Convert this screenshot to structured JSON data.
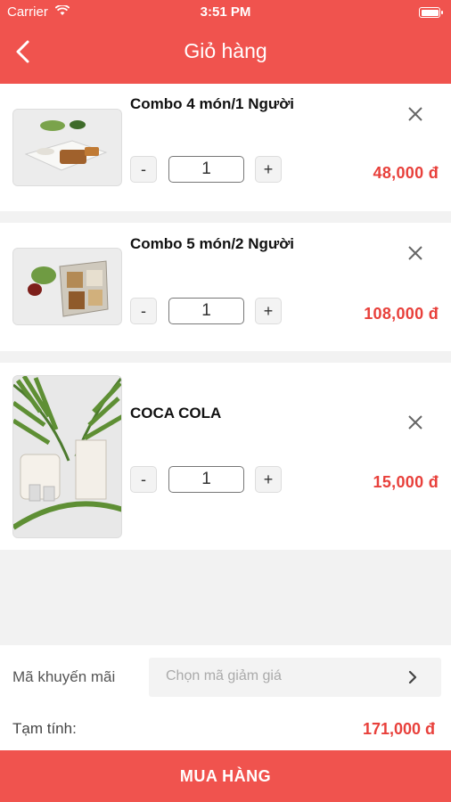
{
  "status_bar": {
    "carrier": "Carrier",
    "time": "3:51 PM"
  },
  "nav": {
    "title": "Giỏ hàng"
  },
  "cart_items": [
    {
      "name": "Combo 4 món/1 Người",
      "quantity": "1",
      "price": "48,000 đ",
      "minus": "-",
      "plus": "+"
    },
    {
      "name": "Combo 5 món/2 Người",
      "quantity": "1",
      "price": "108,000 đ",
      "minus": "-",
      "plus": "+"
    },
    {
      "name": "COCA COLA",
      "quantity": "1",
      "price": "15,000 đ",
      "minus": "-",
      "plus": "+"
    }
  ],
  "promo": {
    "label": "Mã khuyến mãi",
    "placeholder": "Chọn mã giảm giá"
  },
  "subtotal": {
    "label": "Tạm tính:",
    "value": "171,000 đ"
  },
  "checkout": {
    "label": "MUA HÀNG"
  },
  "colors": {
    "accent": "#f0534e",
    "price": "#e8403b",
    "background": "#f2f2f2"
  },
  "icons": [
    "back-icon",
    "wifi-icon",
    "battery-icon",
    "close-icon",
    "chevron-right-icon"
  ]
}
